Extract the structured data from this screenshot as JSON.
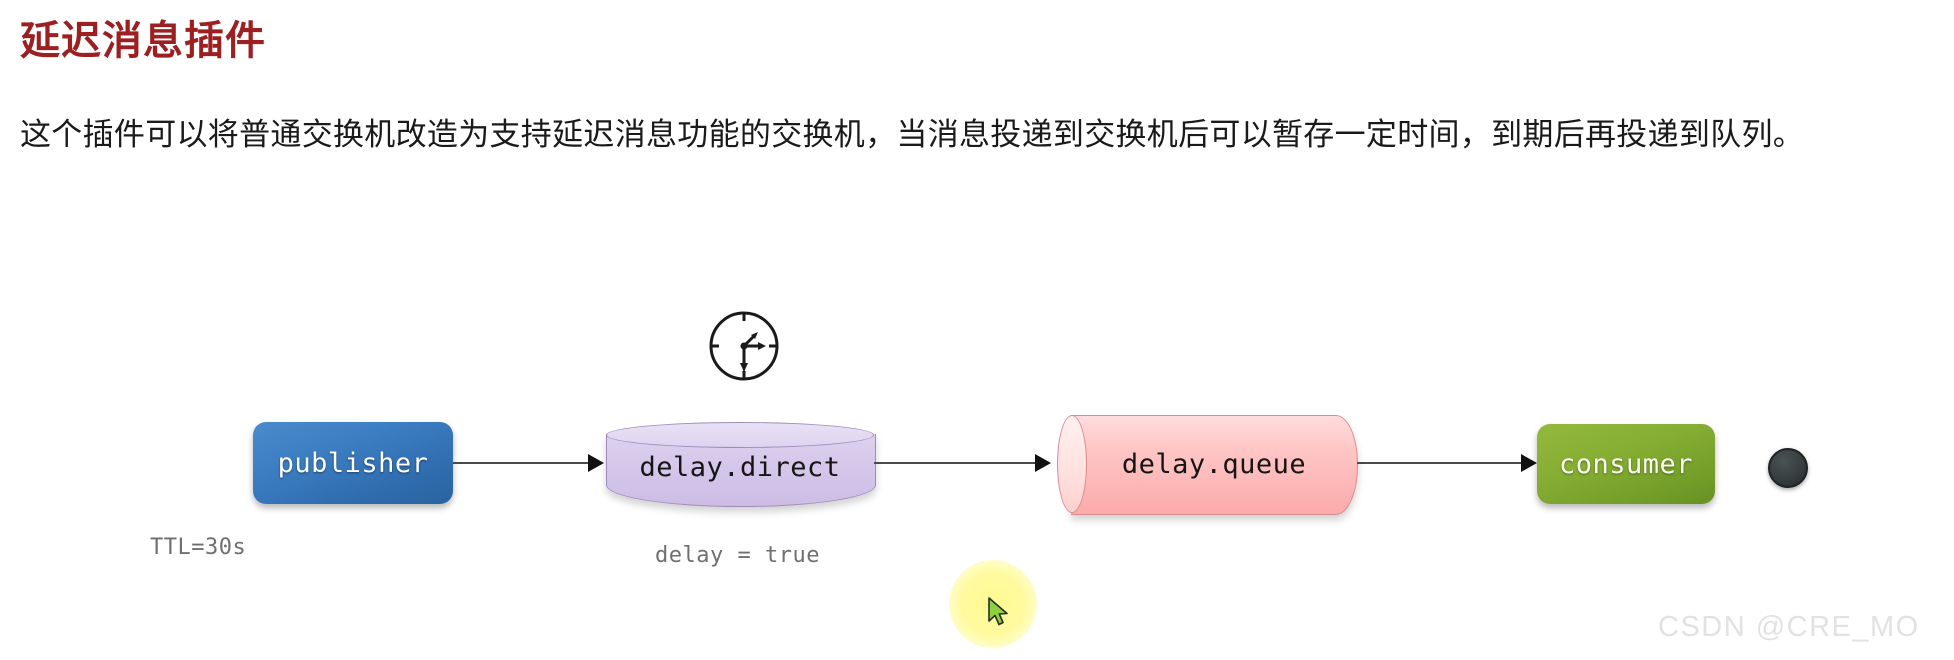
{
  "page": {
    "title": "延迟消息插件",
    "title_color": "#9c2022",
    "body_paragraph": "这个插件可以将普通交换机改造为支持延迟消息功能的交换机，当消息投递到交换机后可以暂存一定时间，到期后再投递到队列。",
    "watermark": "CSDN @CRE_MO"
  },
  "diagram": {
    "nodes": [
      {
        "id": "publisher",
        "label": "publisher",
        "shape": "rounded-rect",
        "color": "#3c7ec2",
        "text_color": "#ffffff"
      },
      {
        "id": "exchange",
        "label": "delay.direct",
        "shape": "cylinder",
        "color": "#d4c7ea",
        "text_color": "#151515"
      },
      {
        "id": "queue",
        "label": "delay.queue",
        "shape": "queue-cylinder",
        "color": "#ffc5c5",
        "text_color": "#151515"
      },
      {
        "id": "consumer",
        "label": "consumer",
        "shape": "rounded-rect",
        "color": "#86ae33",
        "text_color": "#fbfff0"
      }
    ],
    "captions": {
      "ttl": "TTL=30s",
      "delay_flag": "delay = true"
    },
    "icons": {
      "clock": "clock-icon",
      "endpoint": "endpoint-dot",
      "cursor": "mouse-pointer-icon"
    },
    "arrows": [
      {
        "from": "publisher",
        "to": "exchange"
      },
      {
        "from": "exchange",
        "to": "queue"
      },
      {
        "from": "queue",
        "to": "consumer"
      }
    ],
    "arrow_color": "#4a4a4a",
    "caption_color": "#6f6f6f",
    "highlight_color": "#fff98c"
  }
}
